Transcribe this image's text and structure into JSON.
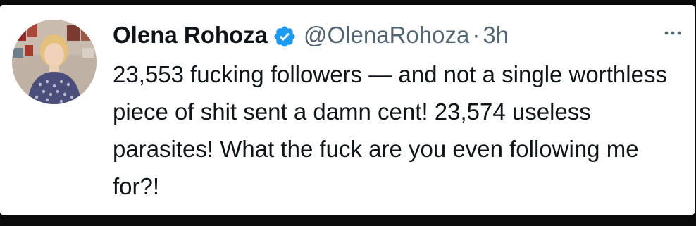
{
  "tweet": {
    "display_name": "Olena Rohoza",
    "handle": "@OlenaRohoza",
    "separator": "·",
    "time": "3h",
    "text": "23,553 fucking followers — and not a single worthless piece of shit sent a damn cent! 23,574 useless parasites! What the fuck are you even following me for?!"
  },
  "icons": {
    "verified": "verified-badge-icon",
    "more": "more-options-icon"
  },
  "colors": {
    "verified_blue": "#1d9bf0",
    "secondary_text": "#536471",
    "primary_text": "#0f1419",
    "background": "#ffffff",
    "frame": "#0b0b0b"
  }
}
